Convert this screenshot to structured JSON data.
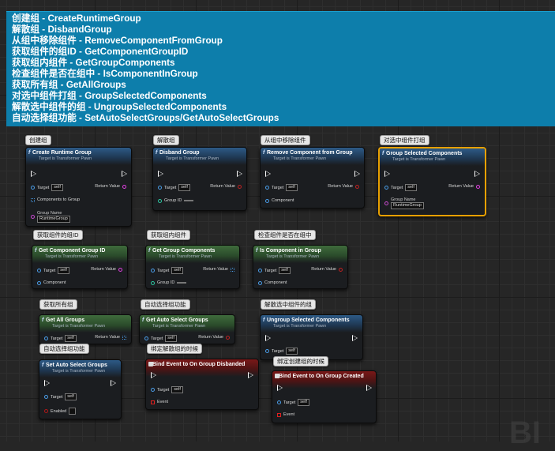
{
  "description": {
    "lines": [
      "创建组 - CreateRuntimeGroup",
      "解散组 - DisbandGroup",
      "从组中移除组件 - RemoveComponentFromGroup",
      "获取组件的组ID - GetComponentGroupID",
      "获取组内组件 - GetGroupComponents",
      "检查组件是否在组中 - IsComponentInGroup",
      "获取所有组 - GetAllGroups",
      "对选中组件打组 - GroupSelectedComponents",
      "解散选中组件的组 - UngroupSelectedComponents",
      "自动选择组功能 - SetAutoSelectGroups/GetAutoSelectGroups"
    ]
  },
  "comments": {
    "create": "创建组",
    "disband": "解散组",
    "remove": "从组中移除组件",
    "group_selected": "对选中组件打组",
    "get_group_id": "获取组件的组ID",
    "get_group_components": "获取组内组件",
    "is_in_group": "检查组件是否在组中",
    "get_all": "获取所有组",
    "auto_select": "自动选择组功能",
    "ungroup": "解散选中组件的组",
    "auto_select_set": "自动选择组功能",
    "bind_disband": "绑定解散组的时候",
    "bind_create": "绑定创建组的时候"
  },
  "common": {
    "subtitle": "Target is Transformer Pawn",
    "target": "Target",
    "self": "self",
    "return_value": "Return Value",
    "component": "Component",
    "group_id": "Group ID",
    "group_name": "Group Name",
    "event": "Event",
    "enabled": "Enabled",
    "function_glyph": "f"
  },
  "nodes": {
    "create": {
      "title": "Create Runtime Group",
      "components_label": "Components to Group",
      "group_name_value": "RuntimeGroup"
    },
    "disband": {
      "title": "Disband Group"
    },
    "remove": {
      "title": "Remove Component from Group"
    },
    "group_selected": {
      "title": "Group Selected Components",
      "group_name_value": "RuntimeGroup"
    },
    "get_group_id": {
      "title": "Get Component Group ID"
    },
    "get_group_components": {
      "title": "Get Group Components"
    },
    "is_in_group": {
      "title": "Is Component in Group"
    },
    "get_all": {
      "title": "Get All Groups"
    },
    "get_auto": {
      "title": "Get Auto Select Groups"
    },
    "ungroup": {
      "title": "Ungroup Selected Components"
    },
    "set_auto": {
      "title": "Set Auto Select Groups"
    },
    "bind_disband": {
      "title": "Bind Event to On Group Disbanded"
    },
    "bind_create": {
      "title": "Bind Event to On Group Created"
    }
  },
  "colors": {
    "description_bg": "#0d7eab",
    "selected_outline": "#e8a000",
    "pure_header": "#3f6b3c",
    "callable_header": "#2d5a86",
    "event_header": "#7a1818"
  },
  "watermark": "BI"
}
